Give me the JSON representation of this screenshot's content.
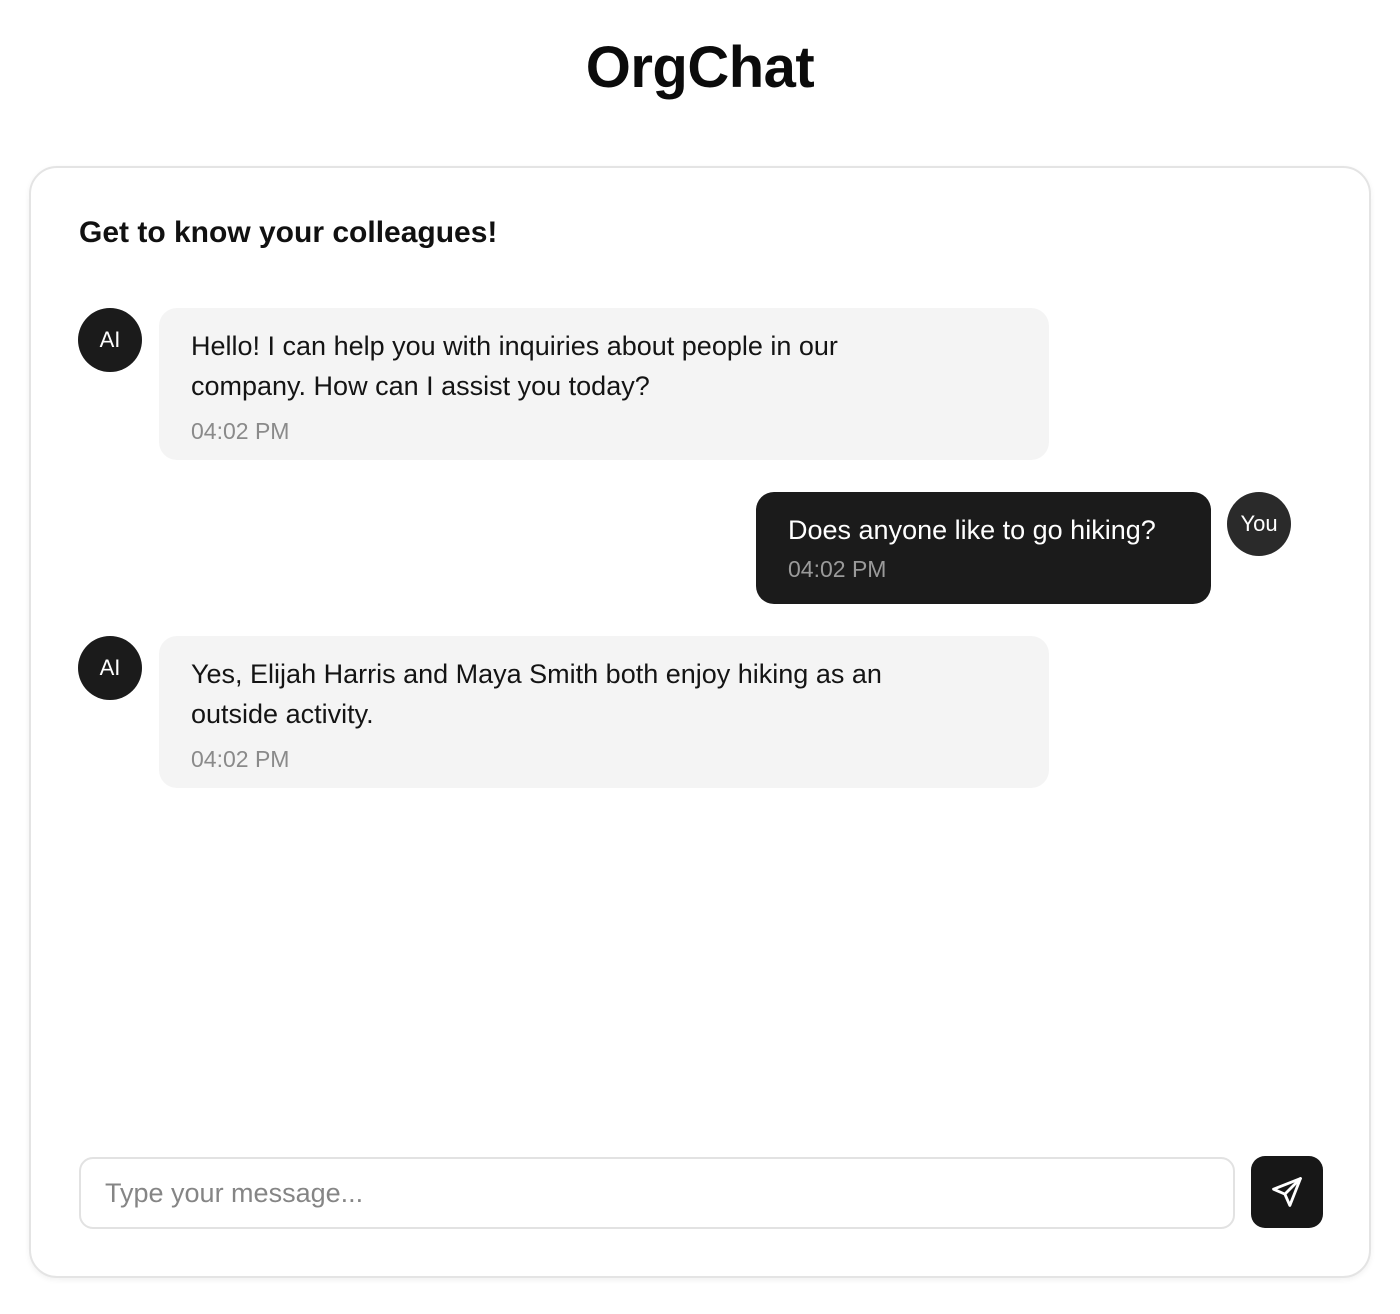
{
  "app": {
    "title": "OrgChat"
  },
  "chat": {
    "heading": "Get to know your colleagues!",
    "messages": [
      {
        "sender": "ai",
        "avatar": "AI",
        "text": "Hello! I can help you with inquiries about people in our company. How can I assist you today?",
        "time": "04:02 PM"
      },
      {
        "sender": "user",
        "avatar": "You",
        "text": "Does anyone like to go hiking?",
        "time": "04:02 PM"
      },
      {
        "sender": "ai",
        "avatar": "AI",
        "text": "Yes, Elijah Harris and Maya Smith both enjoy hiking as an outside activity.",
        "time": "04:02 PM"
      }
    ]
  },
  "composer": {
    "placeholder": "Type your message...",
    "value": ""
  },
  "send_button": {
    "icon": "send-icon"
  },
  "colors": {
    "ai_bubble": "#f4f4f4",
    "user_bubble": "#1b1b1b",
    "avatar": "#1b1b1b",
    "timestamp": "#8a8a8a"
  }
}
